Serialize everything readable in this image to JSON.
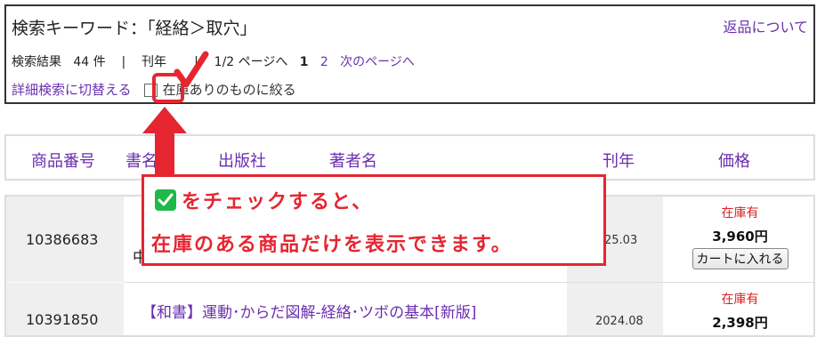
{
  "search": {
    "title": "検索キーワード：「経絡＞取穴」",
    "returns_link": "返品について",
    "results_label": "検索結果",
    "count": "44 件",
    "sep1": "|",
    "sort_label": "刊年",
    "sep2": "|",
    "page_info": "1/2 ページへ",
    "page_current": "1",
    "page_2": "2",
    "next_page": "次のページへ",
    "detail_search": "詳細検索に切替える",
    "stock_filter": "在庫ありのものに絞る"
  },
  "table": {
    "headers": [
      "商品番号",
      "書名",
      "出版社",
      "著者名",
      "刊年",
      "価格"
    ],
    "rows": [
      {
        "id": "10386683",
        "title": "中",
        "date": "25.03",
        "stock": "在庫有",
        "price": "3,960円",
        "cart": "カートに入れる"
      },
      {
        "id": "10391850",
        "title": "【和書】運動･からだ図解-経絡･ツボの基本[新版]",
        "date": "2024.08",
        "stock": "在庫有",
        "price": "2,398円"
      }
    ]
  },
  "annotation": {
    "line1": "をチェックすると、",
    "line2": "在庫のある商品だけを表示できます。"
  },
  "colors": {
    "accent_red": "#e52631",
    "link_purple": "#6a2fb0",
    "check_green": "#1fb94a"
  }
}
